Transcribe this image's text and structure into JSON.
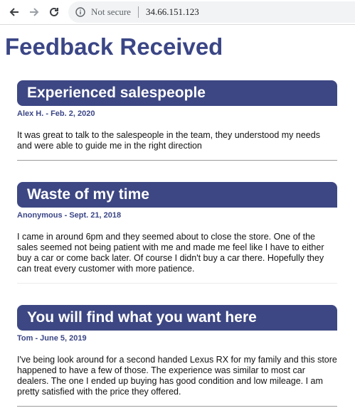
{
  "browser": {
    "security_label": "Not secure",
    "url": "34.66.151.123"
  },
  "page": {
    "title": "Feedback Received"
  },
  "reviews": [
    {
      "title": "Experienced salespeople",
      "meta": "Alex H. - Feb. 2, 2020",
      "body": "It was great to talk to the salespeople in the team, they understood my needs and were able to guide me in the right direction"
    },
    {
      "title": "Waste of my time",
      "meta": "Anonymous - Sept. 21, 2018",
      "body": "I came in around 6pm and they seemed about to close the store. One of the sales seemed not being patient with me and made me feel like I have to either buy a car or come back later. Of course I didn't buy a car there. Hopefully they can treat every customer with more patience."
    },
    {
      "title": "You will find what you want here",
      "meta": "Tom - June 5, 2019",
      "body": "I've being look around for a second handed Lexus RX for my family and this store happened to have a few of those. The experience was similar to most car dealers. The one I ended up buying has good condition and low mileage. I am pretty satisfied with the price they offered."
    }
  ],
  "colors": {
    "accent": "#3d4783",
    "title": "#3b4686"
  },
  "icons": {
    "back": "arrow-left-icon",
    "forward": "arrow-right-icon",
    "reload": "reload-icon",
    "info": "info-icon"
  }
}
